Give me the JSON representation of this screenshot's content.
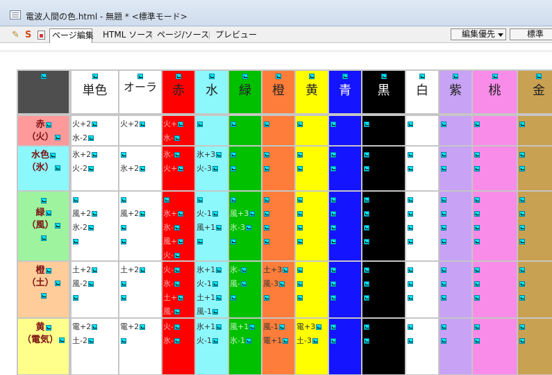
{
  "window": {
    "title": "電波人間の色.html - 無題 * <標準モード>"
  },
  "toolbar": {
    "tabs": [
      "ページ編集",
      "HTML ソース",
      "ページ/ソース",
      "プレビュー"
    ],
    "edit_priority": "編集優先",
    "standard": "標準"
  },
  "colors": {
    "corner": "#4e4e4e",
    "white": "#ffffff",
    "red": "#ff0000",
    "cyan": "#8cf8fc",
    "green": "#00c000",
    "orange": "#ff7d3a",
    "yellow": "#ffff00",
    "blue": "#1414ff",
    "black": "#000000",
    "purple": "#c7a2f5",
    "pink": "#f98ce8",
    "gold": "#c9a152",
    "row_red": "#ff9a9a",
    "row_cyan": "#8cf8fc",
    "row_green": "#9ef49e",
    "row_orange": "#ffcc9a",
    "row_yellow": "#ffff8c"
  },
  "table": {
    "headers": [
      "",
      "単色",
      "オーラ",
      "赤",
      "水",
      "緑",
      "橙",
      "黄",
      "青",
      "黒",
      "白",
      "紫",
      "桃",
      "金"
    ],
    "rows": [
      {
        "label": [
          "赤",
          "（火）"
        ],
        "cells": [
          [
            "火+2",
            "水-2"
          ],
          [
            "火+2"
          ],
          [
            "火+",
            "水-"
          ],
          [
            ""
          ],
          [
            ""
          ],
          [
            ""
          ],
          [
            ""
          ],
          [
            ""
          ],
          [
            ""
          ],
          [
            ""
          ],
          [
            ""
          ],
          [
            ""
          ],
          [
            ""
          ]
        ]
      },
      {
        "label": [
          "水色",
          "（氷）"
        ],
        "cells": [
          [
            "氷+2",
            "火-2"
          ],
          [
            "",
            "氷+2"
          ],
          [
            "氷-",
            "火+"
          ],
          [
            "氷+3",
            "火-3"
          ],
          [
            "",
            ""
          ],
          [
            "",
            ""
          ],
          [
            "",
            ""
          ],
          [
            "",
            ""
          ],
          [
            "",
            ""
          ],
          [
            "",
            ""
          ],
          [
            "",
            ""
          ],
          [
            "",
            ""
          ],
          [
            "",
            ""
          ]
        ]
      },
      {
        "label": [
          "",
          "緑",
          "（風）",
          ""
        ],
        "cells": [
          [
            "",
            "風+2",
            "氷-2",
            ""
          ],
          [
            "",
            "風+2",
            "",
            ""
          ],
          [
            "",
            "氷+",
            "氷-",
            "風+",
            "火-"
          ],
          [
            "",
            "火-1",
            "風+1",
            ""
          ],
          [
            "",
            "風+3",
            "氷-3",
            ""
          ],
          [
            "",
            "",
            "",
            ""
          ],
          [
            "",
            "",
            "",
            ""
          ],
          [
            "",
            "",
            "",
            ""
          ],
          [
            "",
            "",
            "",
            ""
          ],
          [
            "",
            "",
            "",
            ""
          ],
          [
            "",
            "",
            "",
            ""
          ],
          [
            "",
            "",
            "",
            ""
          ],
          [
            "",
            "",
            "",
            ""
          ]
        ]
      },
      {
        "label": [
          "橙",
          "（土）",
          ""
        ],
        "cells": [
          [
            "土+2",
            "風-2",
            ""
          ],
          [
            "土+2",
            "",
            ""
          ],
          [
            "火-",
            "氷-",
            "土+",
            "風-"
          ],
          [
            "氷+1",
            "火-1",
            "土+1",
            "風-1"
          ],
          [
            "氷-",
            "風-",
            ""
          ],
          [
            "土+3",
            "風-3",
            ""
          ],
          [
            "",
            "",
            ""
          ],
          [
            "",
            "",
            ""
          ],
          [
            "",
            "",
            ""
          ],
          [
            "",
            "",
            ""
          ],
          [
            "",
            "",
            ""
          ],
          [
            "",
            "",
            ""
          ],
          [
            "",
            "",
            ""
          ]
        ]
      },
      {
        "label": [
          "黄",
          "（電気）"
        ],
        "cells": [
          [
            "電+2",
            "土-2"
          ],
          [
            "電+2",
            ""
          ],
          [
            "火-",
            "氷-"
          ],
          [
            "氷+1",
            "火-1"
          ],
          [
            "風+1",
            "氷-1"
          ],
          [
            "風-1",
            "電+1"
          ],
          [
            "電+3",
            "土-3"
          ],
          [
            "",
            ""
          ],
          [
            "",
            ""
          ],
          [
            "",
            ""
          ],
          [
            "",
            ""
          ],
          [
            "",
            ""
          ],
          [
            "",
            ""
          ]
        ]
      }
    ]
  }
}
